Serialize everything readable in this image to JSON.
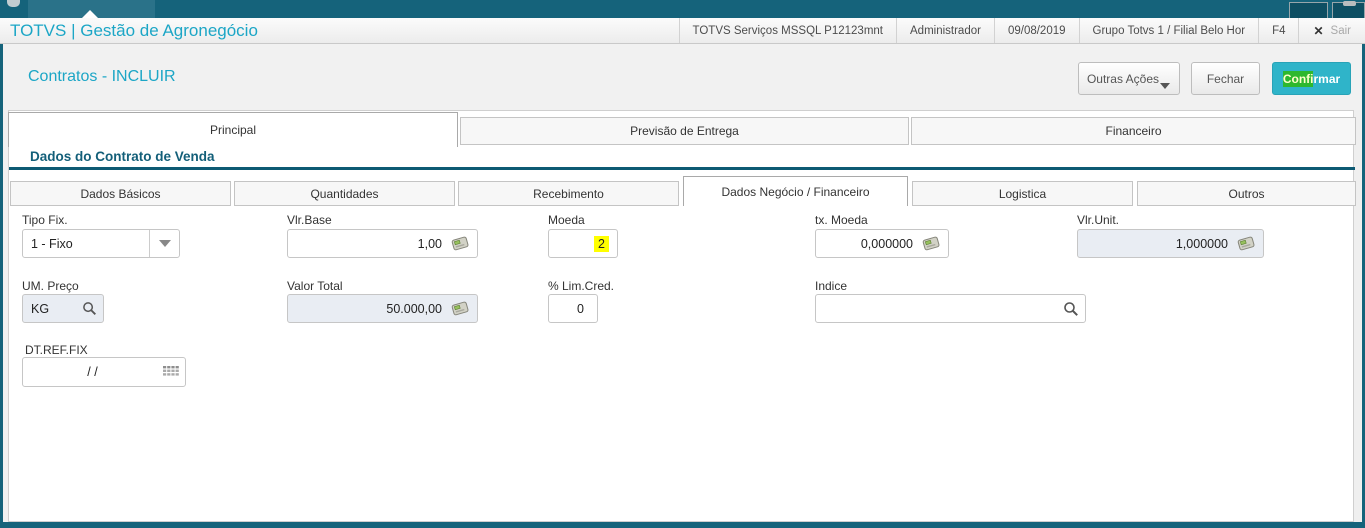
{
  "header": {
    "title": "TOTVS | Gestão de Agronegócio",
    "environment": "TOTVS Serviços MSSQL P12123mnt",
    "user": "Administrador",
    "date": "09/08/2019",
    "group": "Grupo Totvs 1 / Filial Belo Hor",
    "f4": "F4",
    "exit_icon": "✕",
    "exit": "Sair"
  },
  "toolbar": {
    "page_title": "Contratos - INCLUIR",
    "other_actions": "Outras Ações",
    "close": "Fechar",
    "confirm_highlight": "Confi",
    "confirm_rest": "rmar"
  },
  "main_tabs": {
    "principal": "Principal",
    "previsao": "Previsão de Entrega",
    "financeiro": "Financeiro",
    "active": "Principal"
  },
  "section_title": "Dados do Contrato de Venda",
  "sub_tabs": {
    "dados_basicos": "Dados Básicos",
    "quantidades": "Quantidades",
    "recebimento": "Recebimento",
    "dados_negocio": "Dados Negócio / Financeiro",
    "logistica": "Logistica",
    "outros": "Outros",
    "active": "Dados Negócio / Financeiro"
  },
  "form": {
    "tipo_fix": {
      "label": "Tipo Fix.",
      "value": "1 - Fixo"
    },
    "vlr_base": {
      "label": "Vlr.Base",
      "value": "1,00"
    },
    "moeda": {
      "label": "Moeda",
      "value": "2"
    },
    "tx_moeda": {
      "label": "tx. Moeda",
      "value": "0,000000"
    },
    "vlr_unit": {
      "label": "Vlr.Unit.",
      "value": "1,000000"
    },
    "um_preco": {
      "label": "UM. Preço",
      "value": "KG"
    },
    "valor_total": {
      "label": "Valor Total",
      "value": "50.000,00"
    },
    "lim_cred": {
      "label": "% Lim.Cred.",
      "value": "0"
    },
    "indice": {
      "label": "Indice",
      "value": ""
    },
    "dt_ref_fix": {
      "label": "DT.REF.FIX",
      "value": "/ /"
    }
  },
  "colors": {
    "accent_teal": "#15637b",
    "title_cyan": "#1ca6c6",
    "confirm_button": "#2fb4c9",
    "search_highlight_green": "#2eb82e",
    "selection_highlight_yellow": "#ffff00",
    "disabled_field_bg": "#e9edf3"
  }
}
